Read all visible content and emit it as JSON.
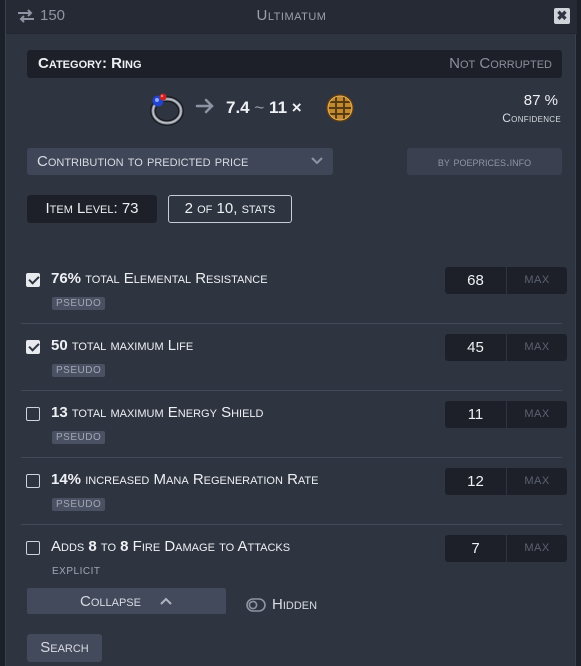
{
  "titlebar": {
    "swap_icon": "swap-arrows-icon",
    "count": "150",
    "title": "Ultimatum",
    "close_glyph": "✖"
  },
  "category": {
    "label": "Category: Ring",
    "corrupted": "Not Corrupted"
  },
  "price": {
    "min": "7.4",
    "sep": "~",
    "max": "11",
    "times": "×",
    "currency_icon": "divine-orb-icon",
    "item_icon": "ring-icon",
    "confidence_value": "87 %",
    "confidence_label": "Confidence"
  },
  "toolbar": {
    "contribution_label": "Contribution to predicted price",
    "source_label": "by poeprices.info"
  },
  "info": {
    "item_level": "Item Level: 73",
    "stats_badge": "2 of 10, stats"
  },
  "mods": [
    {
      "checked": true,
      "num": "76%",
      "text": " total Elemental Resistance",
      "tag": "pseudo",
      "value": "68",
      "max_placeholder": "max"
    },
    {
      "checked": true,
      "num": "50",
      "text": " total maximum Life",
      "tag": "pseudo",
      "value": "45",
      "max_placeholder": "max"
    },
    {
      "checked": false,
      "num": "13",
      "text": " total maximum Energy Shield",
      "tag": "pseudo",
      "value": "11",
      "max_placeholder": "max"
    },
    {
      "checked": false,
      "num": "14%",
      "text": " increased Mana Regeneration Rate",
      "tag": "pseudo",
      "value": "12",
      "max_placeholder": "max"
    },
    {
      "checked": false,
      "pre": "Adds ",
      "num": "8",
      "mid": " to ",
      "num2": "8",
      "text": " Fire Damage to Attacks",
      "tag": "explicit",
      "value": "7",
      "max_placeholder": "max"
    }
  ],
  "footer": {
    "collapse_label": "Collapse",
    "hidden_label": "Hidden",
    "search_label": "Search"
  },
  "colors": {
    "panel": "#2f3441",
    "dark_field": "#1d2028",
    "button": "#434a5b"
  }
}
